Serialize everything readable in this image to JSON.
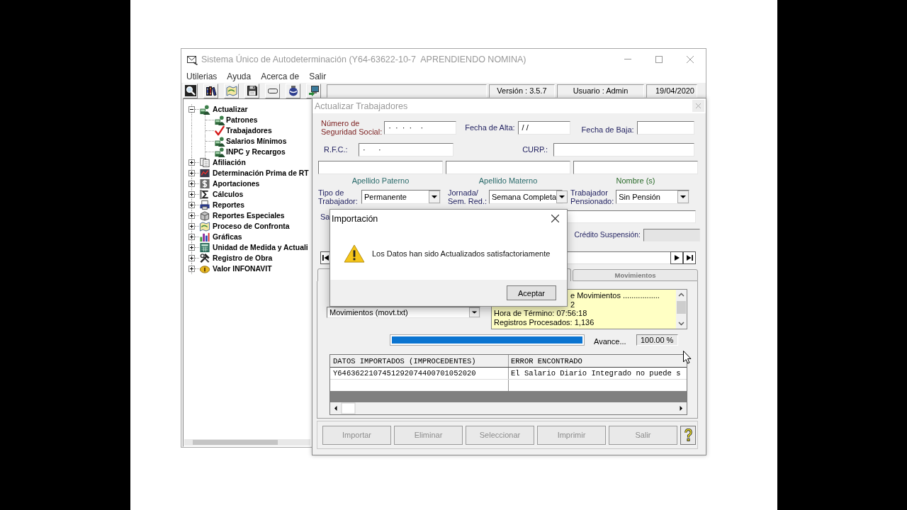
{
  "window": {
    "title": "Sistema Único de Autodeterminación (Y64-63622-10-7  APRENDIENDO NOMINA)"
  },
  "menu": [
    "Utilerias",
    "Ayuda",
    "Acerca de",
    "Salir"
  ],
  "status": [
    "Versión : 3.5.7",
    "Usuario : Admin",
    "19/04/2020"
  ],
  "tree": [
    {
      "label": "Actualizar",
      "expanded": true,
      "children": [
        {
          "label": "Patrones",
          "selected": false
        },
        {
          "label": "Trabajadores",
          "selected": true
        },
        {
          "label": "Salarios Mínimos",
          "selected": false
        },
        {
          "label": "INPC y Recargos",
          "selected": false
        }
      ]
    },
    {
      "label": "Afiliación",
      "expanded": false
    },
    {
      "label": "Determinación Prima de RT",
      "expanded": false
    },
    {
      "label": "Aportaciones",
      "expanded": false
    },
    {
      "label": "Cálculos",
      "expanded": false
    },
    {
      "label": "Reportes",
      "expanded": false
    },
    {
      "label": "Reportes Especiales",
      "expanded": false
    },
    {
      "label": "Proceso de Confronta",
      "expanded": false
    },
    {
      "label": "Gráficas",
      "expanded": false
    },
    {
      "label": "Unidad de Medida y Actuali",
      "expanded": false
    },
    {
      "label": "Registro de Obra",
      "expanded": false
    },
    {
      "label": "Valor INFONAVIT",
      "expanded": false
    }
  ],
  "dialog": {
    "title": "Actualizar Trabajadores",
    "nss": {
      "label": "Número de\nSeguridad Social:",
      "value": "·  ·  ·  ·    ·"
    },
    "fecha_alta": {
      "label": "Fecha de Alta:",
      "value": "/ /"
    },
    "fecha_baja": {
      "label": "Fecha de Baja:"
    },
    "rfc": {
      "label": "R.F.C.:",
      "value": "·      ·"
    },
    "curp": {
      "label": "CURP.:"
    },
    "name_captions": [
      "Apellido Paterno",
      "Apellido Materno",
      "Nombre (s)"
    ],
    "selects": [
      {
        "label": "Tipo de\nTrabajador:",
        "value": "Permanente"
      },
      {
        "label": "Jornada/\nSem. Red.:",
        "value": "Semana Completa"
      },
      {
        "label": "Trabajador\nPensionado:",
        "value": "Sin Pensión"
      }
    ],
    "partial_label": "Sa",
    "credito": {
      "label": "Crédito Suspensión:",
      "disabled": true
    },
    "tabs": [
      {
        "selected": true
      },
      {
        "label": "Movimientos",
        "selected": false
      }
    ],
    "file_select": "Movimientos (movt.txt)",
    "log": [
      "e Movimientos .................",
      "2",
      "Hora de Término: 07:56:18",
      "Registros Procesados: 1,136"
    ],
    "progress": {
      "level": 1,
      "label": "Avance...",
      "reading": "100.00 %"
    },
    "table": {
      "columns": [
        "DATOS IMPORTADOS (IMPROCEDENTES)",
        "ERROR ENCONTRADO"
      ],
      "rows": [
        [
          "Y6463622107451292074400701052020",
          "El Salario Diario Integrado no puede s"
        ]
      ]
    },
    "buttons": [
      {
        "label": "Importar",
        "disabled": true
      },
      {
        "label": "Eliminar",
        "disabled": true
      },
      {
        "label": "Seleccionar",
        "disabled": true
      },
      {
        "label": "Imprimir",
        "disabled": true
      },
      {
        "label": "Salir",
        "disabled": true
      }
    ]
  },
  "modal": {
    "title": "Importación",
    "message": "Los Datos han sido Actualizados satisfactoriamente",
    "button": "Aceptar"
  }
}
